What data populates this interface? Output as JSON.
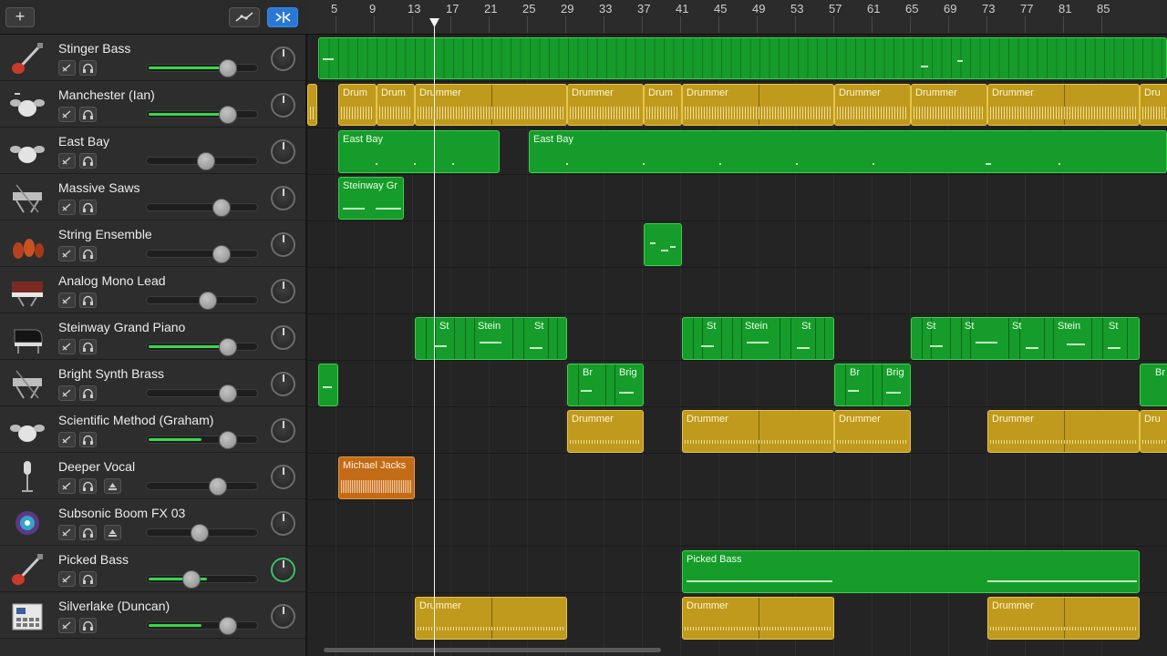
{
  "toolbar": {
    "add_label": "+"
  },
  "ruler": {
    "bars": [
      "5",
      "9",
      "13",
      "17",
      "21",
      "25",
      "29",
      "33",
      "37",
      "41",
      "45",
      "49",
      "53",
      "57",
      "61",
      "65",
      "69",
      "73",
      "77",
      "81",
      "85"
    ]
  },
  "tracks": [
    {
      "name": "Stinger Bass",
      "icon": "bass-guitar-icon",
      "volume": 0.72
    },
    {
      "name": "Manchester (Ian)",
      "icon": "drum-kit-icon",
      "volume": 0.72
    },
    {
      "name": "East Bay",
      "icon": "drum-kit-icon",
      "volume": 0.53
    },
    {
      "name": "Massive Saws",
      "icon": "synth-keyboard-icon",
      "volume": 0.67
    },
    {
      "name": "String Ensemble",
      "icon": "strings-icon",
      "volume": 0.67
    },
    {
      "name": "Analog Mono Lead",
      "icon": "analog-synth-icon",
      "volume": 0.55
    },
    {
      "name": "Steinway Grand Piano",
      "icon": "grand-piano-icon",
      "volume": 0.72
    },
    {
      "name": "Bright Synth Brass",
      "icon": "synth-keyboard-icon",
      "volume": 0.72
    },
    {
      "name": "Scientific Method (Graham)",
      "icon": "drum-kit-icon",
      "volume": 0.72
    },
    {
      "name": "Deeper Vocal",
      "icon": "microphone-icon",
      "volume": 0.63
    },
    {
      "name": "Subsonic Boom FX 03",
      "icon": "fx-burst-icon",
      "volume": 0.47
    },
    {
      "name": "Picked Bass",
      "icon": "bass-guitar-icon",
      "volume": 0.39
    },
    {
      "name": "Silverlake (Duncan)",
      "icon": "drum-machine-icon",
      "volume": 0.72
    }
  ],
  "regions": {
    "manchester": [
      "Drum",
      "Drum",
      "Drummer",
      "Drummer",
      "Drum",
      "Drummer",
      "Drummer",
      "Drummer",
      "Drummer",
      "Dru"
    ],
    "eastbay": [
      "East Bay",
      "East Bay"
    ],
    "massive": "Steinway Gr",
    "steinway": [
      "St",
      "Stein",
      "St",
      "St",
      "Stein",
      "St",
      "St",
      "St",
      "St",
      "Stein",
      "St"
    ],
    "brass": [
      "Br",
      "Brig",
      "Br",
      "Brig",
      "Br"
    ],
    "scientific": [
      "Drummer",
      "Drummer",
      "Drummer",
      "Drummer",
      "Dru"
    ],
    "vocal": "Michael Jacks",
    "picked": "Picked Bass",
    "silverlake": [
      "Drummer",
      "Drummer",
      "Drummer"
    ]
  }
}
